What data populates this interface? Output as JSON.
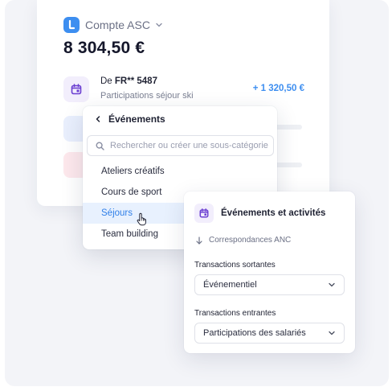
{
  "account": {
    "name": "Compte ASC",
    "balance": "8 304,50 €",
    "transaction": {
      "from_prefix": "De",
      "from_account": "FR** 5487",
      "description": "Participations séjour ski",
      "amount": "+ 1 320,50 €"
    }
  },
  "category_menu": {
    "title": "Événements",
    "search_placeholder": "Rechercher ou créer une sous-catégorie",
    "items": [
      {
        "label": "Ateliers créatifs"
      },
      {
        "label": "Cours de sport"
      },
      {
        "label": "Séjours"
      },
      {
        "label": "Team building"
      }
    ],
    "selected": "Séjours"
  },
  "activity_panel": {
    "title": "Événements et activités",
    "mapping_label": "Correspondances ANC",
    "outgoing": {
      "label": "Transactions sortantes",
      "value": "Événementiel"
    },
    "incoming": {
      "label": "Transactions entrantes",
      "value": "Participations des salariés"
    }
  },
  "colors": {
    "accent": "#3d8ef0",
    "selected_bg": "#e8f1fe",
    "calendar_purple": "#6b3fd1",
    "badge_purple_bg": "#f2eefc",
    "background": "#f3f4f8"
  },
  "icons": {
    "account_logo": "bank-logo-icon",
    "account_chevron": "chevron-down-icon",
    "transaction": "calendar-icon",
    "back": "chevron-left-icon",
    "search": "search-icon",
    "cursor": "hand-pointer-icon",
    "mapping": "arrow-down-icon",
    "select": "chevron-down-icon"
  }
}
